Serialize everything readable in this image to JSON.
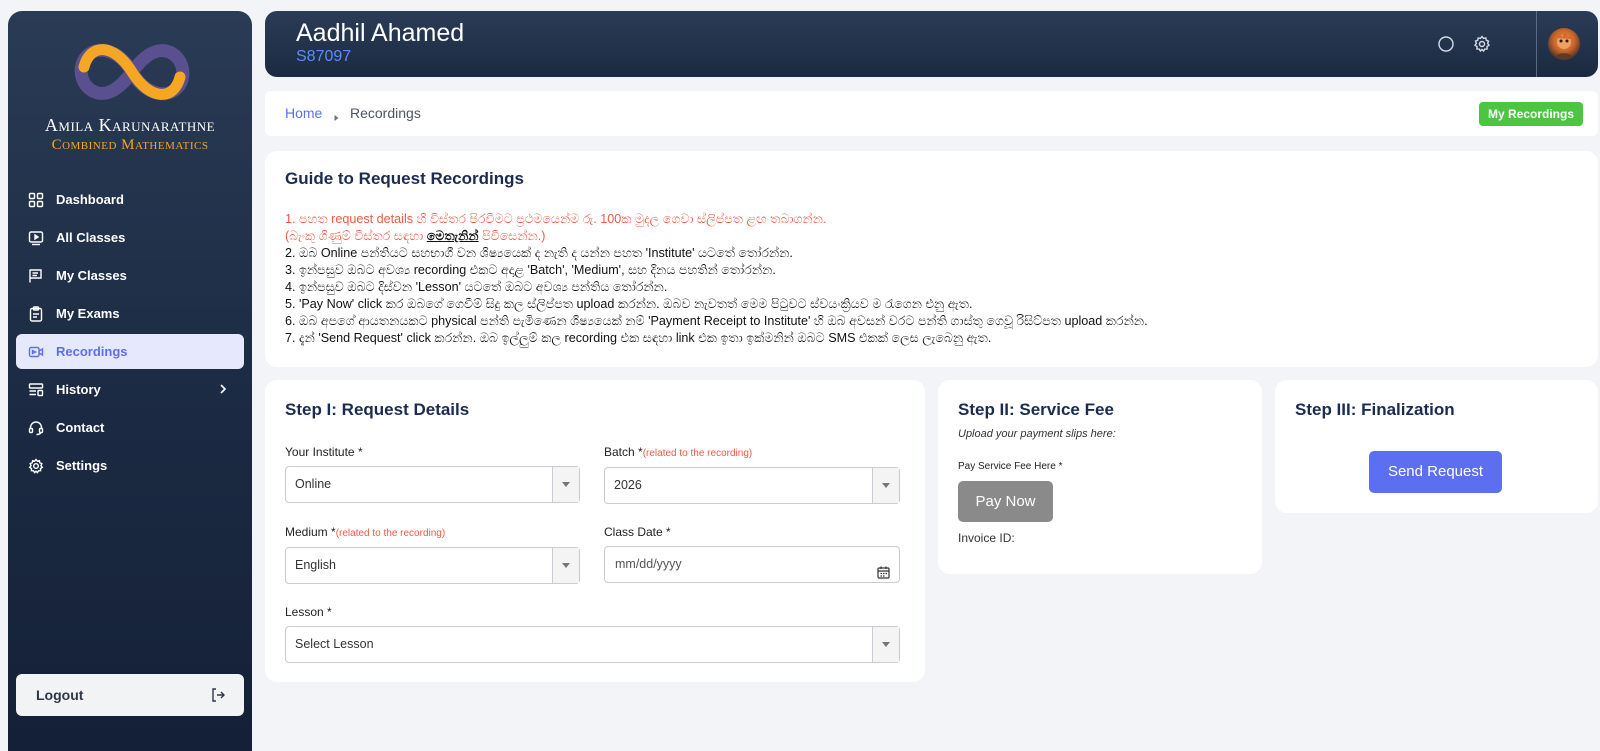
{
  "sidebar": {
    "brand_name": "Amila Karunarathne",
    "brand_sub": "Combined Mathematics",
    "items": [
      {
        "label": "Dashboard",
        "icon": "grid-icon"
      },
      {
        "label": "All Classes",
        "icon": "play-screen-icon"
      },
      {
        "label": "My Classes",
        "icon": "list-board-icon"
      },
      {
        "label": "My Exams",
        "icon": "clipboard-icon"
      },
      {
        "label": "Recordings",
        "icon": "video-icon",
        "active": true
      },
      {
        "label": "History",
        "icon": "history-icon",
        "has_children": true
      },
      {
        "label": "Contact",
        "icon": "headset-icon"
      },
      {
        "label": "Settings",
        "icon": "gear-icon"
      }
    ],
    "logout_label": "Logout"
  },
  "header": {
    "user_name": "Aadhil Ahamed",
    "user_id": "S87097"
  },
  "breadcrumb": {
    "home": "Home",
    "current": "Recordings",
    "my_recordings_label": "My Recordings"
  },
  "guide": {
    "title": "Guide to Request Recordings",
    "line1": "1. පහත request details හි විස්තර පිරවීමට ප්‍රථමයෙන්ම රු. 100ක මුදල ගෙවා ස්ලිප්පත ළඟ තබාගන්න.",
    "line1b_pre": "(බැංකු ගිණුම් විස්තර සඳහා ",
    "line1b_link": "මෙතැනින්",
    "line1b_post": " පිවිසෙන්න.)",
    "line2": "2. ඔබ Online පන්තියට සහභාගී වන ශිෂ්‍යයෙක් ද නැති ද යන්න පහත 'Institute' යටතේ තෝරන්න.",
    "line3": "3. ඉන්පසුව ඔබට අවශ්‍ය recording එකට අදාළ 'Batch', 'Medium', සහ දිනය පහතින් තෝරන්න.",
    "line4": "4. ඉන්පසුව ඔබට දිස්වන 'Lesson' යටතේ ඔබට අවශ්‍ය පන්තිය තෝරන්න.",
    "line5": "5. 'Pay Now' click කර ඔබගේ ගෙවීම් සිදු කල ස්ලිප්පත upload කරන්න. ඔබව නැවතත් මෙම පිටුවට ස්වයංක්‍රියව ම රැගෙන එනු ඇත.",
    "line6": "6. ඔබ අපගේ ආයතනයකට physical පන්ති පැමිණෙන ශිෂ්‍යයෙක් නම් 'Payment Receipt to Institute' හි ඔබ අවසන් වරට පන්ති ගාස්තු ගෙවූ රිසිට්පත upload කරන්න.",
    "line7": "7. දැන් 'Send Request' click කරන්න. ඔබ ඉල්ලුම් කල recording එක සඳහා link එක ඉතා ඉක්මනින් ඔබට SMS එකක් ලෙස ලැබෙනු ඇත."
  },
  "step1": {
    "title": "Step I: Request Details",
    "institute_label": "Your Institute *",
    "institute_value": "Online",
    "batch_label": "Batch *",
    "batch_hint": "(related to the recording)",
    "batch_value": "2026",
    "medium_label": "Medium *",
    "medium_hint": "(related to the recording)",
    "medium_value": "English",
    "date_label": "Class Date *",
    "date_placeholder": "mm/dd/yyyy",
    "lesson_label": "Lesson *",
    "lesson_value": "Select Lesson"
  },
  "step2": {
    "title": "Step II: Service Fee",
    "subtitle": "Upload your payment slips here:",
    "pay_label": "Pay Service Fee Here *",
    "pay_button": "Pay Now",
    "invoice_label": "Invoice ID:"
  },
  "step3": {
    "title": "Step III: Finalization",
    "send_button": "Send Request"
  },
  "colors": {
    "accent": "#5b6ff0",
    "green": "#4cc541",
    "hint_red": "#ef5a43",
    "brand_orange": "#f5a623"
  }
}
